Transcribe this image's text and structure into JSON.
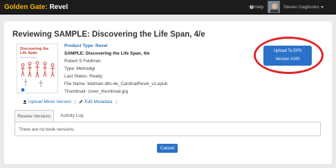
{
  "header": {
    "brand": "Golden Gate:",
    "app_name": "Revel",
    "help_label": "Help",
    "user_name": "Steven Gagliostro"
  },
  "page": {
    "title": "Reviewing SAMPLE: Discovering the Life Span, 4/e"
  },
  "cover": {
    "title": "Discovering the Life Span",
    "author": "Robert S. Feldman"
  },
  "details": {
    "product_type": "Product Type: Revel",
    "book_title": "SAMPLE: Discovering the Life Span, 4/e",
    "author": "Robert S Feldman",
    "type": "Type: Metrodigi",
    "last_status": "Last Status: Ready",
    "file_name": "File Name: feldman-dtls-4e_CardinalRevel_v1.epub",
    "thumbnail": "Thumbnail: cover_thumbnail.jpg"
  },
  "upload_button": {
    "line1": "Upload To EPS",
    "line2": "Version #100"
  },
  "actions": {
    "upload_minor": "Upload Minor Version",
    "separator": "|",
    "edit_metadata": "Edit Metadata",
    "trailing_separator": "|"
  },
  "tabs": [
    {
      "label": "Review Versions",
      "active": true
    },
    {
      "label": "Activity Log",
      "active": false
    }
  ],
  "versions_panel": {
    "empty_message": "There are no book versions."
  },
  "footer": {
    "cancel_label": "Cancel"
  },
  "colors": {
    "brand": "#f5b400",
    "primary": "#2a72c9",
    "link": "#2a6db5",
    "highlight_ring": "#e0242b"
  }
}
